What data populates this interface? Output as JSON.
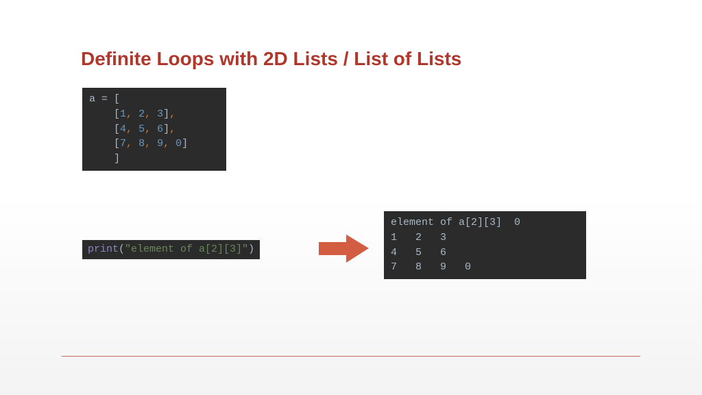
{
  "title": "Definite Loops with 2D Lists / List of Lists",
  "code_a": {
    "l1": {
      "var": "a",
      "eq": " = ",
      "open": "["
    },
    "l2": {
      "pad": "    ",
      "open": "[",
      "n1": "1",
      "c1": ", ",
      "n2": "2",
      "c2": ", ",
      "n3": "3",
      "close": "]",
      "tail": ","
    },
    "l3": {
      "pad": "    ",
      "open": "[",
      "n1": "4",
      "c1": ", ",
      "n2": "5",
      "c2": ", ",
      "n3": "6",
      "close": "]",
      "tail": ","
    },
    "l4": {
      "pad": "    ",
      "open": "[",
      "n1": "7",
      "c1": ", ",
      "n2": "8",
      "c2": ", ",
      "n3": "9",
      "c3": ", ",
      "n4": "0",
      "close": "]"
    },
    "l5": {
      "pad": "    ",
      "close": "]"
    }
  },
  "code_print": {
    "fn": "print",
    "open": "(",
    "str": "\"element of a[2][3]\"",
    "close": ")"
  },
  "output": {
    "l1": "element of a[2][3]  0",
    "l2": "1   2   3",
    "l3": "4   5   6",
    "l4": "7   8   9   0"
  },
  "arrow_color": "#d35d43"
}
